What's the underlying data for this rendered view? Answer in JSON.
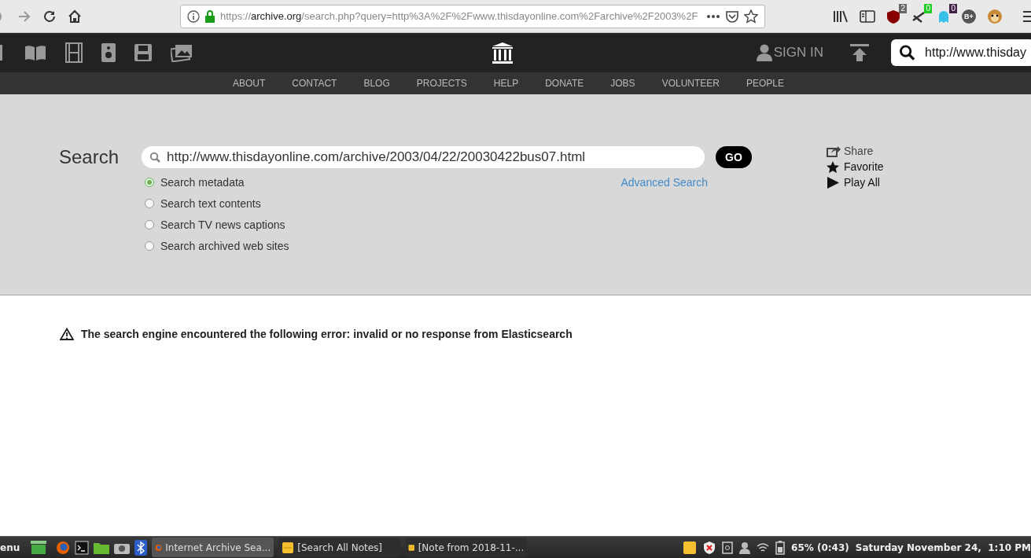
{
  "browser": {
    "url_scheme": "https://",
    "url_host": "archive.org",
    "url_path": "/search.php?query=http%3A%2F%2Fwww.thisdayonline.com%2Farchive%2F2003%2F",
    "extensions": [
      {
        "kind": "badge",
        "badge": "2",
        "color": "#666666"
      },
      {
        "kind": "badge",
        "badge": "0",
        "color": "#22cc22"
      },
      {
        "kind": "badge",
        "badge": "0",
        "color": "#44204a"
      },
      {
        "kind": "letter",
        "badge": "B+",
        "color": "#555555"
      },
      {
        "kind": "plain",
        "color": "#c98a3a"
      }
    ]
  },
  "header": {
    "sign_in": "SIGN IN",
    "search_value": "http://www.thisday"
  },
  "nav": [
    "ABOUT",
    "CONTACT",
    "BLOG",
    "PROJECTS",
    "HELP",
    "DONATE",
    "JOBS",
    "VOLUNTEER",
    "PEOPLE"
  ],
  "search": {
    "label": "Search",
    "query": "http://www.thisdayonline.com/archive/2003/04/22/20030422bus07.html",
    "go": "GO",
    "advanced": "Advanced Search",
    "options": [
      {
        "label": "Search metadata",
        "selected": true
      },
      {
        "label": "Search text contents",
        "selected": false
      },
      {
        "label": "Search TV news captions",
        "selected": false
      },
      {
        "label": "Search archived web sites",
        "selected": false
      }
    ],
    "actions": [
      {
        "kind": "share",
        "label": "Share"
      },
      {
        "kind": "favorite",
        "label": "Favorite"
      },
      {
        "kind": "play",
        "label": "Play All"
      }
    ]
  },
  "error": "The search engine encountered the following error: invalid or no response from Elasticsearch",
  "taskbar": {
    "menu": "enu",
    "tasks": [
      {
        "label": "Internet Archive Sea...",
        "kind": "browser",
        "selected": true
      },
      {
        "label": "[Search All Notes]",
        "kind": "note",
        "selected": false
      },
      {
        "label": "[Note from 2018-11-...",
        "kind": "note",
        "selected": false
      }
    ],
    "battery": "65% (0:43)",
    "clock": "Saturday November 24,  1:10 PM"
  }
}
